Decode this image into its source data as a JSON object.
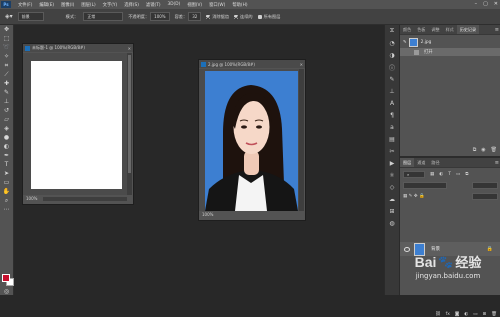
{
  "menu": {
    "items": [
      "文件(F)",
      "编辑(E)",
      "图像(I)",
      "图层(L)",
      "文字(Y)",
      "选择(S)",
      "滤镜(T)",
      "3D(D)",
      "视图(V)",
      "窗口(W)",
      "帮助(H)"
    ]
  },
  "options": {
    "preset": "前景",
    "mode_label": "模式：",
    "mode_value": "正常",
    "opacity_label": "不透明度：",
    "opacity_value": "100%",
    "tolerance_label": "容差：",
    "tolerance_value": "32",
    "antialias": "消除锯齿",
    "contiguous": "连续的",
    "all_layers": "所有图层"
  },
  "doc_untitled": {
    "title": "未标题-1 @ 100%(RGB/8#)",
    "status": "100%"
  },
  "doc_photo": {
    "title": "2.jpg @ 100%(RGB/8#)",
    "status": "100%"
  },
  "history_panel": {
    "tabs": [
      "颜色",
      "色板",
      "调整",
      "样式",
      "历史记录"
    ],
    "active_tab": "历史记录",
    "snapshot": "2.jpg",
    "steps": [
      "打开"
    ]
  },
  "layers_panel": {
    "tabs": [
      "图层",
      "通道",
      "路径"
    ],
    "active_tab": "图层",
    "layer_name": "背景"
  },
  "watermark": {
    "logo_text": "Bai",
    "brand": "经验",
    "url": "jingyan.baidu.com"
  },
  "colors": {
    "foreground": "#c8102e",
    "background": "#ffffff",
    "photo_bg": "#3d7fd1"
  }
}
